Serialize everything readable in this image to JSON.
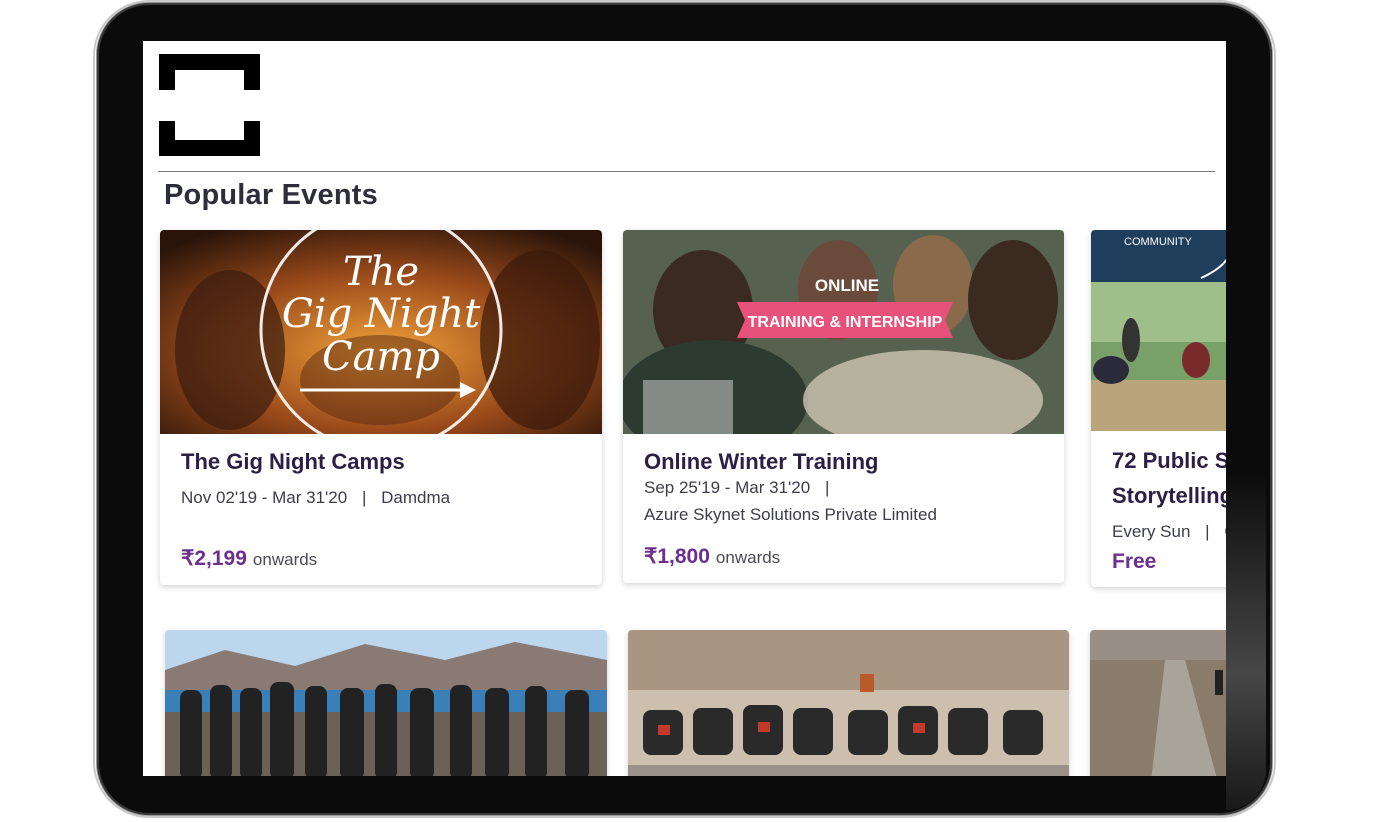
{
  "section": {
    "title": "Popular Events"
  },
  "events": [
    {
      "title": "The Gig Night Camps",
      "dates": "Nov 02'19 - Mar 31'20",
      "separator": "|",
      "location": "Damdma",
      "price": "₹2,199",
      "price_suffix": "onwards",
      "image_text": {
        "line1": "The",
        "line2": "Gig Night",
        "line3": "Camp"
      }
    },
    {
      "title": "Online Winter Training",
      "dates": "Sep 25'19 - Mar 31'20",
      "separator": "|",
      "location": "Azure Skynet Solutions Private Limited",
      "price": "₹1,800",
      "price_suffix": "onwards",
      "image_text": {
        "line1": "ONLINE",
        "banner": "TRAINING & INTERNSHIP"
      }
    },
    {
      "title_line1": "72 Public S",
      "title_line2": "Storytelling",
      "dates": "Every Sun",
      "separator": "|",
      "location": "C",
      "price": "Free",
      "image_text": {
        "tag": "COMMUNITY"
      }
    }
  ],
  "colors": {
    "price": "#6c2f8f",
    "title": "#2b1f45",
    "banner": "#e8517a"
  }
}
